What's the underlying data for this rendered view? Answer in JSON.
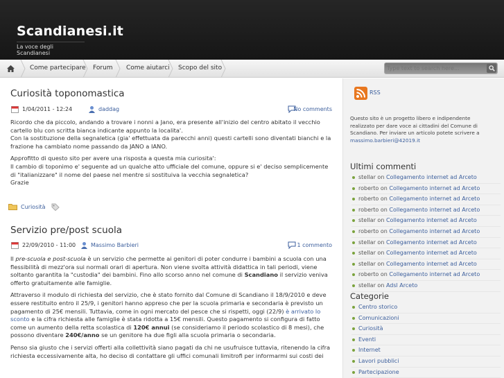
{
  "site": {
    "title": "Scandianesi.it",
    "tagline": "La voce degli Scandianesi"
  },
  "nav": {
    "items": [
      {
        "label": "Come partecipare"
      },
      {
        "label": "Forum"
      },
      {
        "label": "Come aiutarci"
      },
      {
        "label": "Scopo del sito"
      }
    ],
    "search_placeholder": "Type text to search here..."
  },
  "posts": [
    {
      "title": "Curiosità toponomastica",
      "date": "1/04/2011 - 12:24",
      "author": "daddag",
      "comments": "No comments",
      "paragraphs": [
        "Ricordo che da piccolo, andando a trovare i nonni a Jano, era presente all'inizio del centro abitato il vecchio cartello blu con scritta bianca indicante appunto la localita'.",
        "Con la sostituzione della segnaletica (gia' effettuata da parecchi anni) questi cartelli sono diventati bianchi e la frazione ha cambiato nome passando da JANO a IANO.",
        "Approfitto di questo sito per avere una risposta a questa mia curiosita':",
        "Il cambio di toponimo e' seguente ad un qualche atto ufficiale del comune, oppure si e' deciso semplicemente di \"italianizzare\" il nome del paese nel mentre si sostituiva la vecchia segnaletica?",
        "Grazie"
      ],
      "category": "Curiosità"
    },
    {
      "title": "Servizio pre/post scuola",
      "date": "22/09/2010 - 11:00",
      "author": "Massimo Barbieri",
      "comments": "1 commento",
      "p1": {
        "a": "Il ",
        "em": "pre-scuola e post-scuola",
        "b": " è un servizio che permette ai genitori di poter condurre i bambini a scuola con una flessibilità di mezz'ora sui normali orari di apertura. Non viene svolta attività didattica in tali periodi, viene soltanto garantita la \"custodia\" dei bambini. Fino allo scorso anno nel comune di ",
        "strong": "Scandiano",
        "c": " il servizio veniva offerto gratuitamente alle famiglie."
      },
      "p2": {
        "a": "Attraverso il modulo di richiesta del servizio, che è stato fornito dal Comune di Scandiano il 18/9/2010 e deve essere restituito entro il 25/9, i genitori hanno appreso che per la scuola primaria e secondaria è previsto un pagamento di 25€ mensili. Tuttavia, come in ogni mercato del pesce che si rispetti, oggi (22/9) ",
        "link": "è arrivato lo sconto",
        "b": " e la cifra richiesta alle famiglie è stata ridotta a 15€ mensili. Questo pagamento si configura di fatto come un aumento della retta scolastica di ",
        "strong1": "120€ annui",
        "c": " (se consideriamo il periodo scolastico di 8 mesi), che possono diventare ",
        "strong2": "240€/anno",
        "d": " se un genitore ha due figli alla scuola primaria o secondaria."
      },
      "p3": "Penso sia giusto che i servizi offerti alla collettività siano pagati da chi ne usufruisce tuttavia, ritenendo la cifra richiesta eccessivamente alta, ho deciso di contattare gli uffici comunali limitrofi per informarmi sui costi dei"
    }
  ],
  "sidebar": {
    "rss_label": "RSS",
    "about": "Questo sito è un progetto libero e indipendente realizzato per dare voce ai cittadini del Comune di Scandiano. Per inviare un articolo potete scrivere a ",
    "about_email": "massimo.barbieri@42019.it",
    "recent_title": "Ultimi commenti",
    "recent": [
      {
        "who": "stellar",
        "on": " on ",
        "post": "Collegamento internet ad Arceto"
      },
      {
        "who": "roberto",
        "on": " on ",
        "post": "Collegamento internet ad Arceto"
      },
      {
        "who": "roberto",
        "on": " on ",
        "post": "Collegamento internet ad Arceto"
      },
      {
        "who": "roberto",
        "on": " on ",
        "post": "Collegamento internet ad Arceto"
      },
      {
        "who": "stellar",
        "on": " on ",
        "post": "Collegamento internet ad Arceto"
      },
      {
        "who": "roberto",
        "on": " on ",
        "post": "Collegamento internet ad Arceto"
      },
      {
        "who": "stellar",
        "on": " on ",
        "post": "Collegamento internet ad Arceto"
      },
      {
        "who": "stellar",
        "on": " on ",
        "post": "Collegamento internet ad Arceto"
      },
      {
        "who": "stellar",
        "on": " on ",
        "post": "Collegamento internet ad Arceto"
      },
      {
        "who": "roberto",
        "on": " on ",
        "post": "Collegamento internet ad Arceto"
      },
      {
        "who": "stellar",
        "on": " on ",
        "post": "Adsl Arceto"
      }
    ],
    "categories_title": "Categorie",
    "categories": [
      "Centro storico",
      "Comunicazioni",
      "Curiosità",
      "Eventi",
      "Internet",
      "Lavori pubblici",
      "Partecipazione"
    ]
  },
  "colors": {
    "header_bg": "#1e1e1e",
    "link": "#3b5e9c",
    "bullet": "#7aa23c",
    "rss": "#e8771f"
  }
}
